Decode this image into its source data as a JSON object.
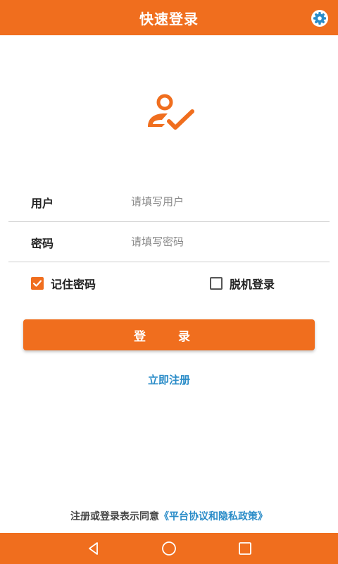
{
  "header": {
    "title": "快速登录",
    "settings_icon": "gear-icon"
  },
  "logo": {
    "icon": "user-check-icon"
  },
  "form": {
    "username": {
      "label": "用户",
      "placeholder": "请填写用户",
      "value": ""
    },
    "password": {
      "label": "密码",
      "placeholder": "请填写密码",
      "value": ""
    }
  },
  "options": {
    "remember": {
      "label": "记住密码",
      "checked": true
    },
    "offline": {
      "label": "脱机登录",
      "checked": false
    }
  },
  "login_button": {
    "label": "登 录"
  },
  "register_link": {
    "label": "立即注册"
  },
  "agreement": {
    "prefix": "注册或登录表示同意",
    "link": "《平台协议和隐私政策》"
  },
  "navbar": {
    "back_icon": "back-triangle-icon",
    "home_icon": "home-circle-icon",
    "recent_icon": "recent-square-icon"
  },
  "colors": {
    "accent": "#f06e1e",
    "link": "#2a8cc8"
  }
}
